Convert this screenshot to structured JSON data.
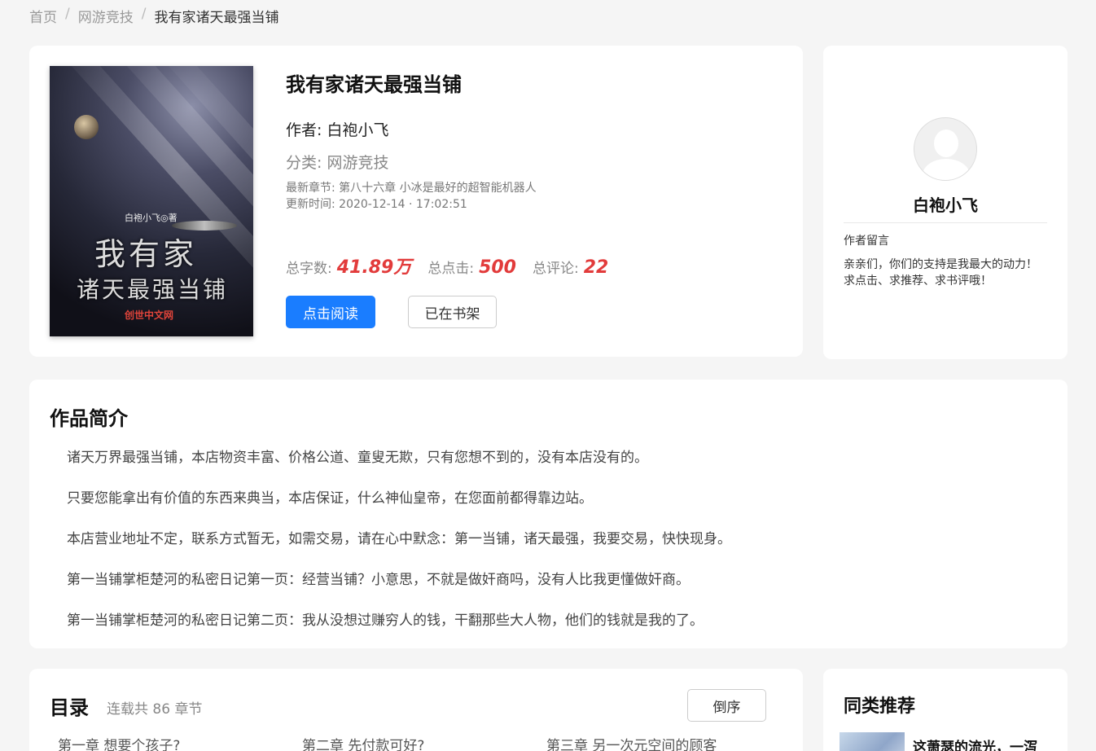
{
  "breadcrumb": {
    "home": "首页",
    "category": "网游竞技",
    "current": "我有家诸天最强当铺",
    "sep": "/"
  },
  "book": {
    "cover": {
      "byline": "白袍小飞◎著",
      "title_line1": "我有家",
      "title_line2": "诸天最强当铺",
      "publisher": "创世中文网"
    },
    "title": "我有家诸天最强当铺",
    "author": "作者: 白袍小飞",
    "category": "分类: 网游竞技",
    "latest_chapter": "最新章节: 第八十六章 小冰是最好的超智能机器人",
    "update_time": "更新时间: 2020-12-14 · 17:02:51",
    "stats": {
      "words_label": "总字数:",
      "words": "41.89万",
      "clicks_label": "总点击:",
      "clicks": "500",
      "comments_label": "总评论:",
      "comments": "22"
    },
    "read_button": "点击阅读",
    "shelf_button": "已在书架"
  },
  "author_card": {
    "name": "白袍小飞",
    "note_heading": "作者留言",
    "note": "亲亲们，你们的支持是我最大的动力！求点击、求推荐、求书评哦！"
  },
  "intro": {
    "heading": "作品简介",
    "paragraphs": [
      "诸天万界最强当铺，本店物资丰富、价格公道、童叟无欺，只有您想不到的，没有本店没有的。",
      "只要您能拿出有价值的东西来典当，本店保证，什么神仙皇帝，在您面前都得靠边站。",
      "本店营业地址不定，联系方式暂无，如需交易，请在心中默念：第一当铺，诸天最强，我要交易，快快现身。",
      "第一当铺掌柜楚河的私密日记第一页：经营当铺？小意思，不就是做奸商吗，没有人比我更懂做奸商。",
      "第一当铺掌柜楚河的私密日记第二页：我从没想过赚穷人的钱，干翻那些大人物，他们的钱就是我的了。"
    ]
  },
  "toc": {
    "heading": "目录",
    "count": "连载共 86 章节",
    "sort_button": "倒序",
    "chapters": [
      "第一章 想要个孩子?",
      "第二章 先付款可好?",
      "第三章 另一次元空间的顾客"
    ]
  },
  "recommend": {
    "heading": "同类推荐",
    "first_title": "这萧瑟的流光，一泻"
  }
}
